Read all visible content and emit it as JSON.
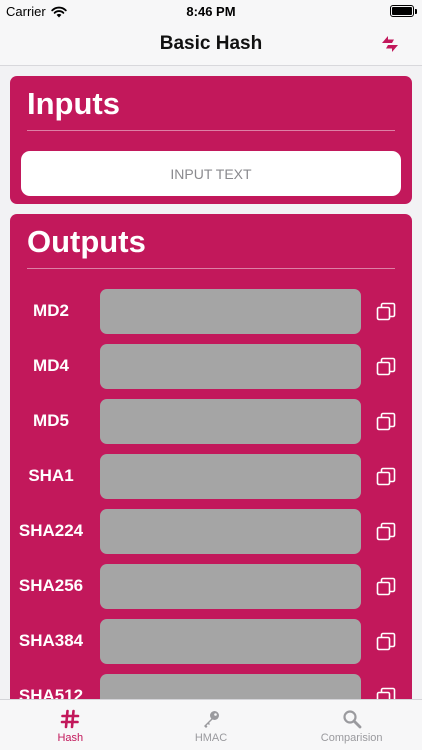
{
  "status_bar": {
    "carrier": "Carrier",
    "time": "8:46 PM"
  },
  "nav": {
    "title": "Basic Hash",
    "swap_icon": "swap-arrows-icon"
  },
  "inputs": {
    "heading": "Inputs",
    "placeholder": "INPUT TEXT",
    "value": ""
  },
  "outputs": {
    "heading": "Outputs",
    "rows": [
      {
        "label": "MD2",
        "value": ""
      },
      {
        "label": "MD4",
        "value": ""
      },
      {
        "label": "MD5",
        "value": ""
      },
      {
        "label": "SHA1",
        "value": ""
      },
      {
        "label": "SHA224",
        "value": ""
      },
      {
        "label": "SHA256",
        "value": ""
      },
      {
        "label": "SHA384",
        "value": ""
      },
      {
        "label": "SHA512",
        "value": ""
      }
    ]
  },
  "tabs": [
    {
      "label": "Hash",
      "icon": "hash-icon",
      "active": true
    },
    {
      "label": "HMAC",
      "icon": "key-icon",
      "active": false
    },
    {
      "label": "Comparision",
      "icon": "magnifier-icon",
      "active": false
    }
  ],
  "colors": {
    "accent": "#c2185b",
    "field": "#a5a5a5",
    "tab_inactive": "#9a9a9e"
  }
}
